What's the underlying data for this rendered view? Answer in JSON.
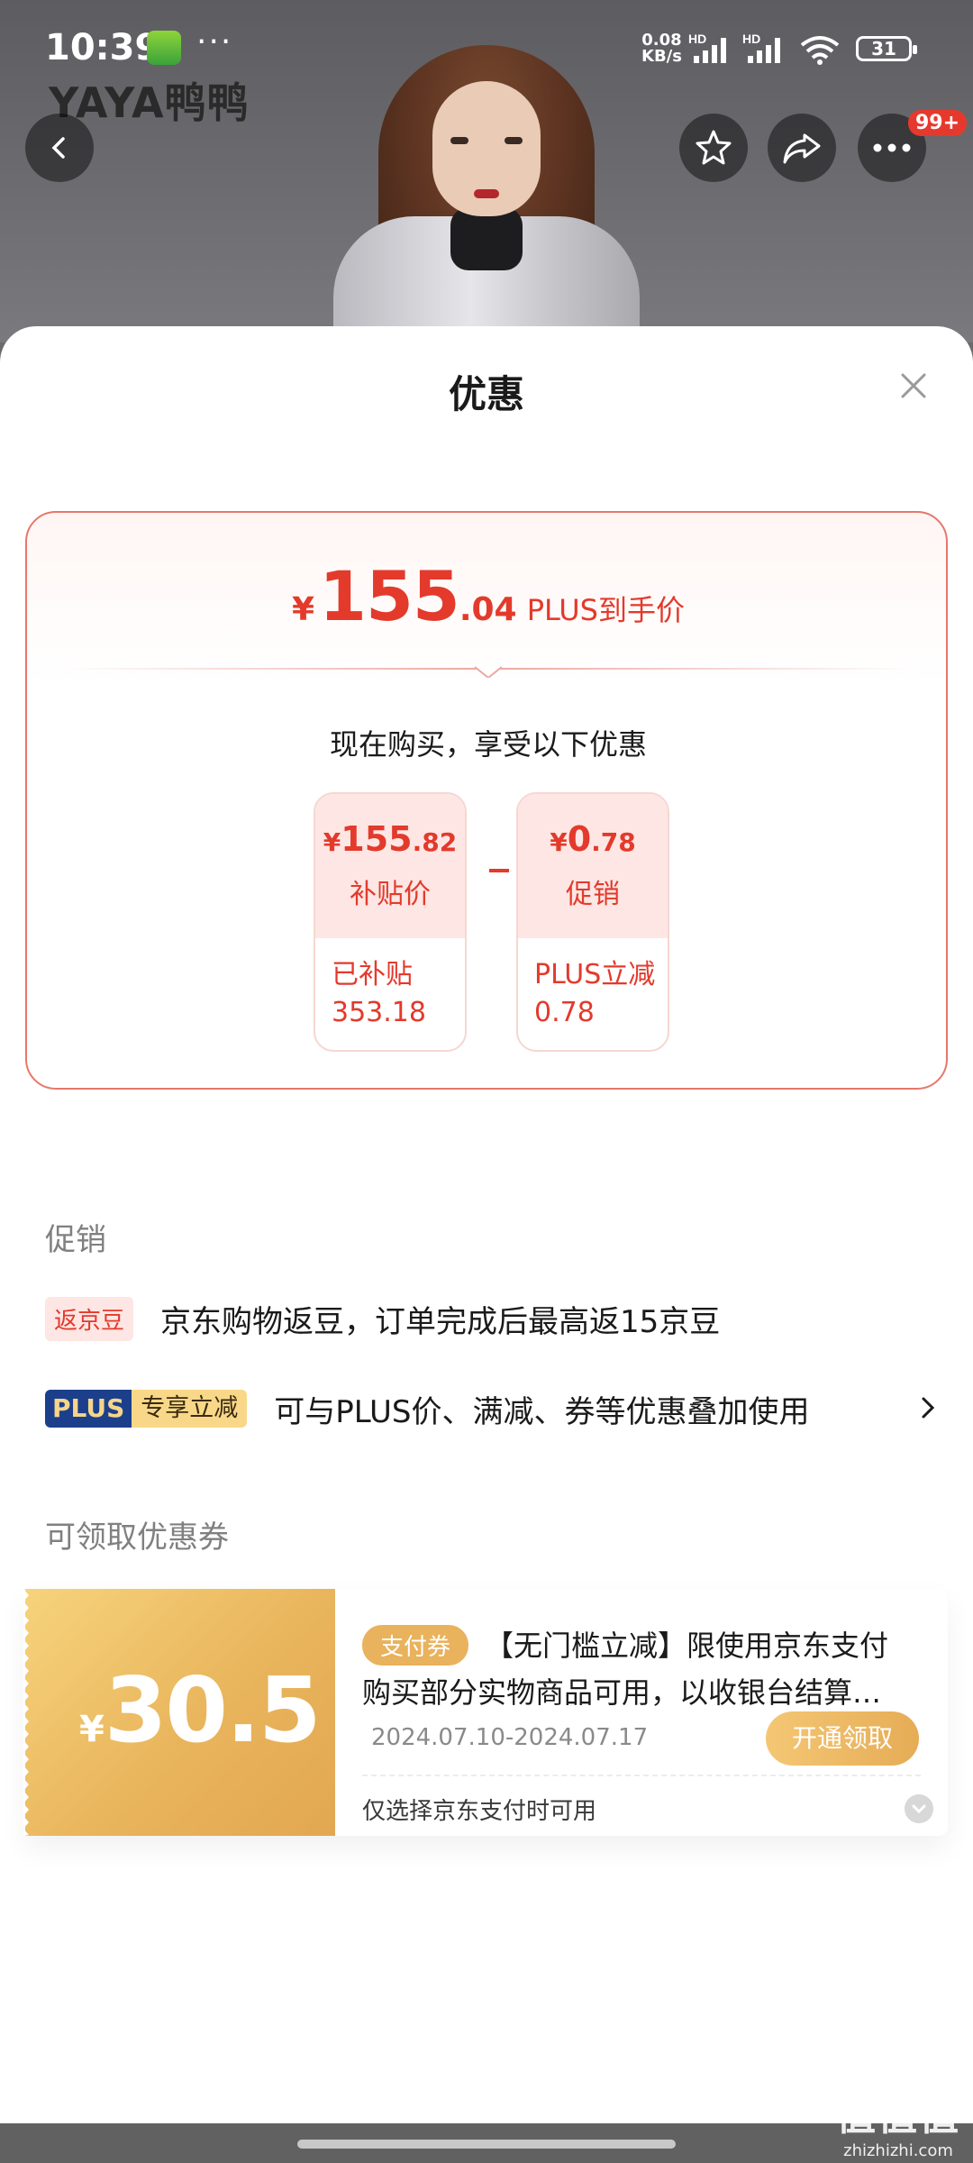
{
  "status_bar": {
    "time": "10:39",
    "more": "···",
    "net_speed": "0.08",
    "net_unit": "KB/s",
    "hd1": "HD",
    "hd2": "HD",
    "battery": "31"
  },
  "brand_logo": "YAYA鸭鸭",
  "more_badge": "99+",
  "sheet": {
    "title": "优惠",
    "final_price": {
      "currency": "¥",
      "integer": "155",
      "decimal": ".04",
      "suffix": "PLUS到手价"
    },
    "buy_note": "现在购买，享受以下优惠",
    "breakdown": [
      {
        "currency": "¥",
        "integer": "155",
        "decimal": ".82",
        "label": "补贴价",
        "detail_line1": "已补贴",
        "detail_line2": "353.18"
      },
      {
        "currency": "¥",
        "integer": "0",
        "decimal": ".78",
        "label": "促销",
        "detail_line1": "PLUS立减",
        "detail_line2": "0.78"
      }
    ],
    "promo_section_label": "促销",
    "promos": [
      {
        "tag": "返京豆",
        "text": "京东购物返豆，订单完成后最高返15京豆"
      },
      {
        "tag_plus": "PLUS",
        "tag_extra": "专享立减",
        "text": "可与PLUS价、满减、券等优惠叠加使用"
      }
    ],
    "coupon_section_label": "可领取优惠券",
    "coupon": {
      "currency": "¥",
      "value": "30.5",
      "tag": "支付券",
      "desc_line1": "【无门槛立减】限使用京东支付",
      "desc_line2": "购买部分实物商品可用，以收银台结算…",
      "date_range": "2024.07.10-2024.07.17",
      "claim_label": "开通领取",
      "note": "仅选择京东支付时可用"
    }
  },
  "watermark": {
    "big": "值值值",
    "small": "zhizhizhi.com"
  },
  "colors": {
    "accent_red": "#e33a2c",
    "gold": "#e9b25d",
    "plus_blue": "#1c3f8c"
  }
}
